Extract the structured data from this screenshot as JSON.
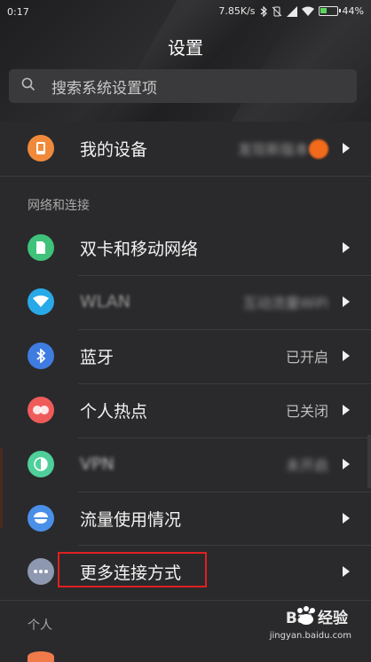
{
  "status_bar": {
    "time": "0:17",
    "network_speed": "7.85K/s",
    "battery_percent": "44%",
    "battery_level": 0.44
  },
  "header": {
    "title": "设置",
    "search_placeholder": "搜索系统设置项"
  },
  "device_row": {
    "label": "我的设备",
    "value": "发现新版本",
    "badge_color": "#f26a1b",
    "icon": "device-icon",
    "icon_color": "#f08a3a"
  },
  "sections": {
    "network": "网络和连接",
    "personal": "个人"
  },
  "network_items": [
    {
      "label": "双卡和移动网络",
      "value": "",
      "icon": "sim-card-icon",
      "icon_color": "#3fc27a"
    },
    {
      "label": "WLAN",
      "value": "互动流量WiFi",
      "icon": "wifi-icon",
      "icon_color": "#2aa9e8"
    },
    {
      "label": "蓝牙",
      "value": "已开启",
      "icon": "bluetooth-icon",
      "icon_color": "#3f7ce0"
    },
    {
      "label": "个人热点",
      "value": "已关闭",
      "icon": "hotspot-icon",
      "icon_color": "#ef5b5b"
    },
    {
      "label": "VPN",
      "value": "未开启",
      "icon": "vpn-icon",
      "icon_color": "#4fcf9a"
    },
    {
      "label": "流量使用情况",
      "value": "",
      "icon": "data-usage-icon",
      "icon_color": "#4a8fe8"
    },
    {
      "label": "更多连接方式",
      "value": "",
      "icon": "more-icon",
      "icon_color": "#8e98b0"
    }
  ],
  "watermark": {
    "brand": "Bai 经验",
    "url": "jingyan.baidu.com"
  }
}
